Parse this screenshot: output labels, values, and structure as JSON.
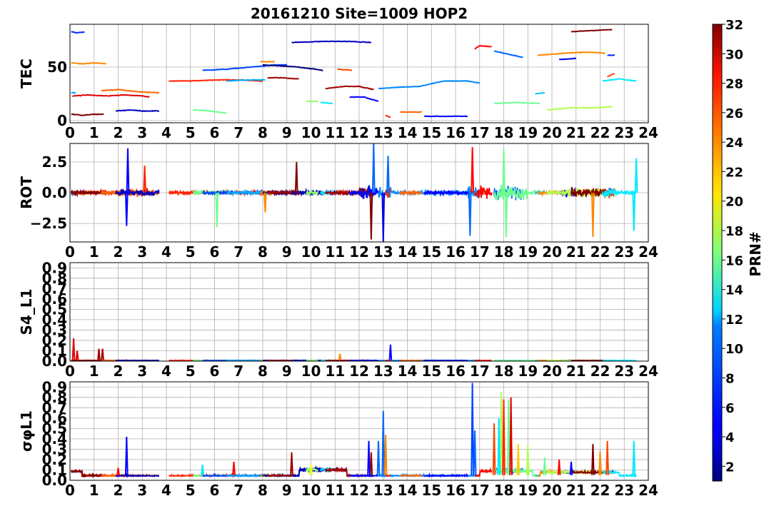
{
  "chart_data": {
    "type": "line",
    "title": "20161210 Site=1009 HOP2",
    "x_ticks": [
      0,
      1,
      2,
      3,
      4,
      5,
      6,
      7,
      8,
      9,
      10,
      11,
      12,
      13,
      14,
      15,
      16,
      17,
      18,
      19,
      20,
      21,
      22,
      23,
      24
    ],
    "xlim": [
      0,
      24
    ],
    "grid": true,
    "colorbar": {
      "label": "PRN#",
      "range": [
        1,
        32
      ],
      "ticks": [
        2,
        4,
        6,
        8,
        10,
        12,
        14,
        16,
        18,
        20,
        22,
        24,
        26,
        28,
        30,
        32
      ],
      "colormap": "jet"
    },
    "panels": [
      {
        "ylabel": "TEC",
        "ylim": [
          -2,
          90
        ],
        "yticks": [
          0,
          50
        ],
        "ytick_labels": [
          "0",
          "50"
        ],
        "series": [
          {
            "prn": 6,
            "x": [
              0.05,
              0.3,
              0.6
            ],
            "y": [
              83,
              82,
              83
            ]
          },
          {
            "prn": 24,
            "x": [
              0.05,
              0.5,
              1.0,
              1.5
            ],
            "y": [
              54,
              53,
              54,
              53
            ]
          },
          {
            "prn": 10,
            "x": [
              0.05,
              0.25
            ],
            "y": [
              26,
              26
            ]
          },
          {
            "prn": 29,
            "x": [
              0.1,
              0.8,
              1.5,
              2.2,
              3.0,
              3.3
            ],
            "y": [
              23,
              24,
              23,
              24,
              23,
              22
            ]
          },
          {
            "prn": 32,
            "x": [
              0.05,
              0.5,
              1.0,
              1.4
            ],
            "y": [
              6,
              5,
              6,
              6
            ]
          },
          {
            "prn": 25,
            "x": [
              1.3,
              2.0,
              2.8,
              3.7
            ],
            "y": [
              28,
              29,
              27,
              26
            ]
          },
          {
            "prn": 3,
            "x": [
              1.9,
              2.5,
              3.0,
              3.7
            ],
            "y": [
              9,
              10,
              9,
              9
            ]
          },
          {
            "prn": 27,
            "x": [
              4.1,
              5.0,
              6.0,
              7.0,
              8.0
            ],
            "y": [
              37,
              37,
              38,
              38,
              37
            ]
          },
          {
            "prn": 16,
            "x": [
              5.1,
              5.8,
              6.5
            ],
            "y": [
              10,
              9,
              7
            ]
          },
          {
            "prn": 7,
            "x": [
              5.5,
              6.5,
              7.5,
              8.5,
              9.0
            ],
            "y": [
              47,
              48,
              50,
              52,
              52
            ]
          },
          {
            "prn": 10,
            "x": [
              6.5,
              7.5,
              8.1
            ],
            "y": [
              37,
              38,
              38
            ]
          },
          {
            "prn": 24,
            "x": [
              7.9,
              8.5
            ],
            "y": [
              55,
              55
            ]
          },
          {
            "prn": 1,
            "x": [
              8.0,
              8.8,
              9.5,
              10.5
            ],
            "y": [
              52,
              51,
              50,
              47
            ]
          },
          {
            "prn": 31,
            "x": [
              8.2,
              8.8,
              9.5
            ],
            "y": [
              40,
              40,
              39
            ]
          },
          {
            "prn": 3,
            "x": [
              9.2,
              10.5,
              11.5,
              12.5
            ],
            "y": [
              73,
              74,
              74,
              73
            ]
          },
          {
            "prn": 17,
            "x": [
              9.8,
              10.3
            ],
            "y": [
              18,
              18
            ]
          },
          {
            "prn": 12,
            "x": [
              10.4,
              10.9
            ],
            "y": [
              17,
              16
            ]
          },
          {
            "prn": 26,
            "x": [
              11.1,
              11.7
            ],
            "y": [
              48,
              47
            ]
          },
          {
            "prn": 31,
            "x": [
              10.6,
              11.4,
              12.0,
              12.6
            ],
            "y": [
              30,
              32,
              32,
              29
            ]
          },
          {
            "prn": 5,
            "x": [
              11.6,
              12.2,
              12.8
            ],
            "y": [
              22,
              22,
              18
            ]
          },
          {
            "prn": 9,
            "x": [
              12.8,
              13.5,
              14.5,
              15.5,
              16.5,
              17.0
            ],
            "y": [
              30,
              31,
              32,
              37,
              37,
              35
            ]
          },
          {
            "prn": 27,
            "x": [
              13.1,
              13.3
            ],
            "y": [
              5,
              3
            ]
          },
          {
            "prn": 25,
            "x": [
              13.7,
              14.6
            ],
            "y": [
              8,
              8
            ]
          },
          {
            "prn": 5,
            "x": [
              14.7,
              15.5,
              16.5
            ],
            "y": [
              4,
              4,
              4
            ]
          },
          {
            "prn": 28,
            "x": [
              16.8,
              17.0,
              17.5
            ],
            "y": [
              67,
              70,
              69
            ]
          },
          {
            "prn": 8,
            "x": [
              17.6,
              18.2,
              18.8
            ],
            "y": [
              65,
              62,
              59
            ]
          },
          {
            "prn": 16,
            "x": [
              17.6,
              18.5,
              19.5
            ],
            "y": [
              16,
              17,
              16
            ]
          },
          {
            "prn": 11,
            "x": [
              19.3,
              19.7
            ],
            "y": [
              25,
              26
            ]
          },
          {
            "prn": 24,
            "x": [
              19.4,
              20.5,
              21.5,
              22.2
            ],
            "y": [
              61,
              63,
              64,
              63
            ]
          },
          {
            "prn": 4,
            "x": [
              20.3,
              21.0
            ],
            "y": [
              57,
              58
            ]
          },
          {
            "prn": 18,
            "x": [
              19.8,
              20.8,
              21.8,
              22.5
            ],
            "y": [
              10,
              12,
              12,
              13
            ]
          },
          {
            "prn": 32,
            "x": [
              20.8,
              21.5,
              22.5
            ],
            "y": [
              83,
              84,
              85
            ]
          },
          {
            "prn": 6,
            "x": [
              22.3,
              22.6
            ],
            "y": [
              61,
              61
            ]
          },
          {
            "prn": 26,
            "x": [
              22.3,
              22.6
            ],
            "y": [
              41,
              44
            ]
          },
          {
            "prn": 12,
            "x": [
              22.1,
              22.8,
              23.5
            ],
            "y": [
              37,
              39,
              37
            ]
          }
        ]
      },
      {
        "ylabel": "ROT",
        "ylim": [
          -4,
          4
        ],
        "yticks": [
          -2.5,
          0.0,
          2.5
        ],
        "ytick_labels": [
          "−2.5",
          "0.0",
          "2.5"
        ],
        "spikes": [
          {
            "prn": 5,
            "x": 2.4,
            "y": 3.6
          },
          {
            "prn": 5,
            "x": 2.35,
            "y": -2.7
          },
          {
            "prn": 27,
            "x": 3.1,
            "y": 2.2
          },
          {
            "prn": 16,
            "x": 6.1,
            "y": -2.8
          },
          {
            "prn": 24,
            "x": 8.1,
            "y": -1.6
          },
          {
            "prn": 32,
            "x": 9.4,
            "y": 2.5
          },
          {
            "prn": 8,
            "x": 12.6,
            "y": 4.0
          },
          {
            "prn": 32,
            "x": 12.5,
            "y": -3.8
          },
          {
            "prn": 4,
            "x": 13.0,
            "y": -4.0
          },
          {
            "prn": 8,
            "x": 13.2,
            "y": 3.0
          },
          {
            "prn": 28,
            "x": 16.7,
            "y": 3.7
          },
          {
            "prn": 8,
            "x": 16.6,
            "y": -3.5
          },
          {
            "prn": 16,
            "x": 18.0,
            "y": 3.5
          },
          {
            "prn": 16,
            "x": 18.1,
            "y": -3.6
          },
          {
            "prn": 24,
            "x": 21.7,
            "y": -3.6
          },
          {
            "prn": 12,
            "x": 23.5,
            "y": 2.8
          },
          {
            "prn": 12,
            "x": 23.4,
            "y": -3.1
          }
        ]
      },
      {
        "ylabel": "S4_L1",
        "ylim": [
          0,
          0.95
        ],
        "yticks": [
          0.0,
          0.1,
          0.2,
          0.3,
          0.4,
          0.5,
          0.6,
          0.7,
          0.8,
          0.9
        ],
        "ytick_labels": [
          "0.0",
          "0.1",
          "0.2",
          "0.3",
          "0.4",
          "0.5",
          "0.6",
          "0.7",
          "0.8",
          "0.9"
        ],
        "spikes": [
          {
            "prn": 29,
            "x": 0.15,
            "y": 0.22
          },
          {
            "prn": 29,
            "x": 0.3,
            "y": 0.1
          },
          {
            "prn": 31,
            "x": 1.2,
            "y": 0.12
          },
          {
            "prn": 31,
            "x": 1.35,
            "y": 0.12
          },
          {
            "prn": 24,
            "x": 11.2,
            "y": 0.07
          },
          {
            "prn": 5,
            "x": 13.3,
            "y": 0.16
          }
        ]
      },
      {
        "ylabel": "σφL1",
        "ylim": [
          0,
          0.95
        ],
        "yticks": [
          0.0,
          0.1,
          0.2,
          0.3,
          0.4,
          0.5,
          0.6,
          0.7,
          0.8,
          0.9
        ],
        "ytick_labels": [
          "0.0",
          "0.1",
          "0.2",
          "0.3",
          "0.4",
          "0.5",
          "0.6",
          "0.7",
          "0.8",
          "0.9"
        ],
        "spikes": [
          {
            "prn": 5,
            "x": 2.35,
            "y": 0.42
          },
          {
            "prn": 28,
            "x": 2.0,
            "y": 0.12
          },
          {
            "prn": 12,
            "x": 5.5,
            "y": 0.15
          },
          {
            "prn": 28,
            "x": 6.8,
            "y": 0.18
          },
          {
            "prn": 31,
            "x": 9.2,
            "y": 0.27
          },
          {
            "prn": 20,
            "x": 10.0,
            "y": 0.15
          },
          {
            "prn": 31,
            "x": 12.5,
            "y": 0.27
          },
          {
            "prn": 8,
            "x": 12.8,
            "y": 0.38
          },
          {
            "prn": 8,
            "x": 13.0,
            "y": 0.67
          },
          {
            "prn": 24,
            "x": 13.1,
            "y": 0.44
          },
          {
            "prn": 5,
            "x": 12.4,
            "y": 0.38
          },
          {
            "prn": 7,
            "x": 16.7,
            "y": 0.94
          },
          {
            "prn": 8,
            "x": 16.8,
            "y": 0.48
          },
          {
            "prn": 26,
            "x": 17.6,
            "y": 0.55
          },
          {
            "prn": 18,
            "x": 17.9,
            "y": 0.85
          },
          {
            "prn": 27,
            "x": 18.0,
            "y": 0.78
          },
          {
            "prn": 16,
            "x": 18.2,
            "y": 0.78
          },
          {
            "prn": 29,
            "x": 18.3,
            "y": 0.8
          },
          {
            "prn": 12,
            "x": 17.8,
            "y": 0.6
          },
          {
            "prn": 22,
            "x": 18.6,
            "y": 0.35
          },
          {
            "prn": 18,
            "x": 19.0,
            "y": 0.34
          },
          {
            "prn": 16,
            "x": 19.7,
            "y": 0.22
          },
          {
            "prn": 28,
            "x": 20.3,
            "y": 0.2
          },
          {
            "prn": 5,
            "x": 20.8,
            "y": 0.18
          },
          {
            "prn": 32,
            "x": 21.7,
            "y": 0.35
          },
          {
            "prn": 24,
            "x": 22.0,
            "y": 0.28
          },
          {
            "prn": 26,
            "x": 22.3,
            "y": 0.38
          },
          {
            "prn": 12,
            "x": 23.4,
            "y": 0.38
          }
        ]
      }
    ]
  }
}
